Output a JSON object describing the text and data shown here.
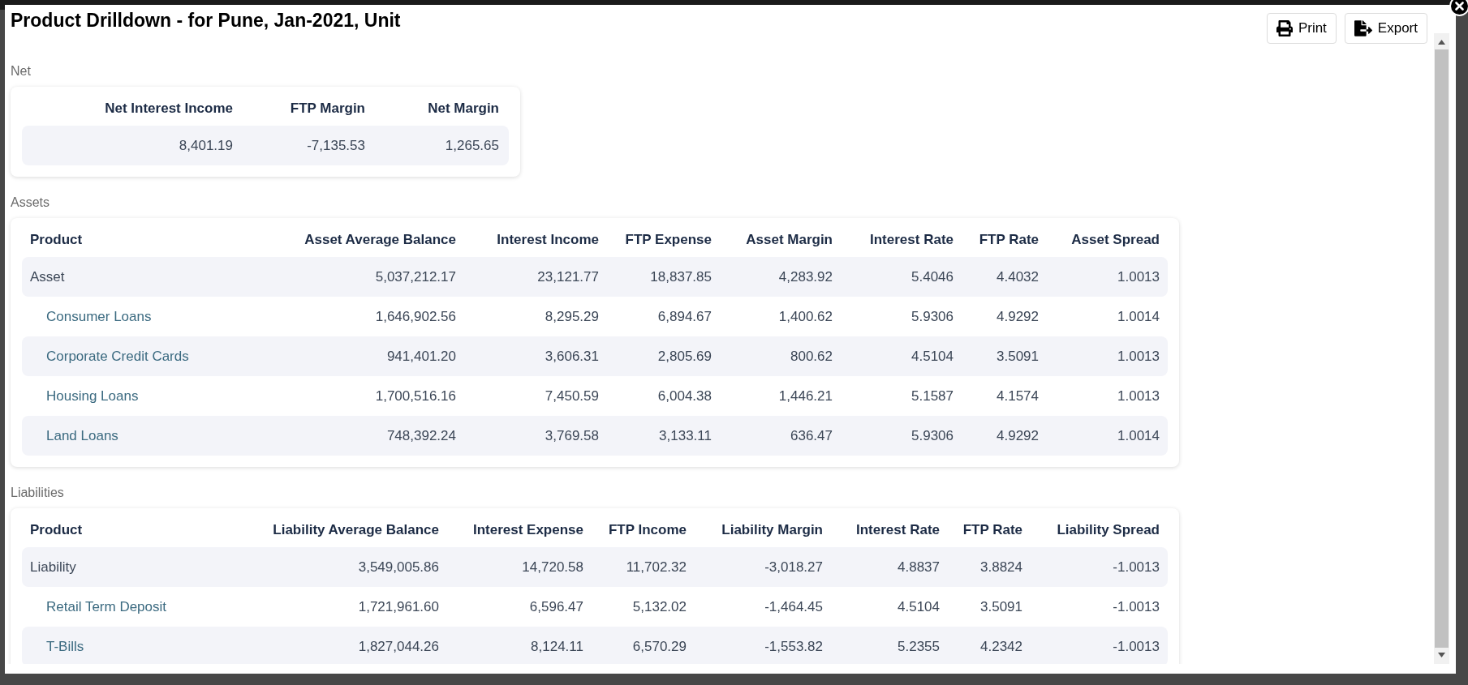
{
  "dialog": {
    "title": "Product Drilldown - for Pune, Jan-2021, Unit",
    "buttons": [
      {
        "kind": "print",
        "label": "Print"
      },
      {
        "kind": "export",
        "label": "Export"
      }
    ]
  },
  "sections": [
    {
      "label": "Net",
      "columns": [
        "Net Interest Income",
        "FTP Margin",
        "Net Margin"
      ],
      "rows": [
        {
          "cells": [
            "8,401.19",
            "-7,135.53",
            "1,265.65"
          ]
        }
      ]
    },
    {
      "label": "Assets",
      "columns": [
        "Product",
        "Asset Average Balance",
        "Interest Income",
        "FTP Expense",
        "Asset Margin",
        "Interest Rate",
        "FTP Rate",
        "Asset Spread"
      ],
      "rows": [
        {
          "kind": "total",
          "cells": [
            "Asset",
            "5,037,212.17",
            "23,121.77",
            "18,837.85",
            "4,283.92",
            "5.4046",
            "4.4032",
            "1.0013"
          ]
        },
        {
          "kind": "child",
          "cells": [
            "Consumer Loans",
            "1,646,902.56",
            "8,295.29",
            "6,894.67",
            "1,400.62",
            "5.9306",
            "4.9292",
            "1.0014"
          ]
        },
        {
          "kind": "child",
          "cells": [
            "Corporate Credit Cards",
            "941,401.20",
            "3,606.31",
            "2,805.69",
            "800.62",
            "4.5104",
            "3.5091",
            "1.0013"
          ]
        },
        {
          "kind": "child",
          "cells": [
            "Housing Loans",
            "1,700,516.16",
            "7,450.59",
            "6,004.38",
            "1,446.21",
            "5.1587",
            "4.1574",
            "1.0013"
          ]
        },
        {
          "kind": "child",
          "cells": [
            "Land Loans",
            "748,392.24",
            "3,769.58",
            "3,133.11",
            "636.47",
            "5.9306",
            "4.9292",
            "1.0014"
          ]
        }
      ]
    },
    {
      "label": "Liabilities",
      "columns": [
        "Product",
        "Liability Average Balance",
        "Interest Expense",
        "FTP Income",
        "Liability Margin",
        "Interest Rate",
        "FTP Rate",
        "Liability Spread"
      ],
      "rows": [
        {
          "kind": "total",
          "cells": [
            "Liability",
            "3,549,005.86",
            "14,720.58",
            "11,702.32",
            "-3,018.27",
            "4.8837",
            "3.8824",
            "-1.0013"
          ]
        },
        {
          "kind": "child",
          "cells": [
            "Retail Term Deposit",
            "1,721,961.60",
            "6,596.47",
            "5,132.02",
            "-1,464.45",
            "4.5104",
            "3.5091",
            "-1.0013"
          ]
        },
        {
          "kind": "child",
          "cells": [
            "T-Bills",
            "1,827,044.26",
            "8,124.11",
            "6,570.29",
            "-1,553.82",
            "5.2355",
            "4.2342",
            "-1.0013"
          ]
        }
      ]
    }
  ]
}
